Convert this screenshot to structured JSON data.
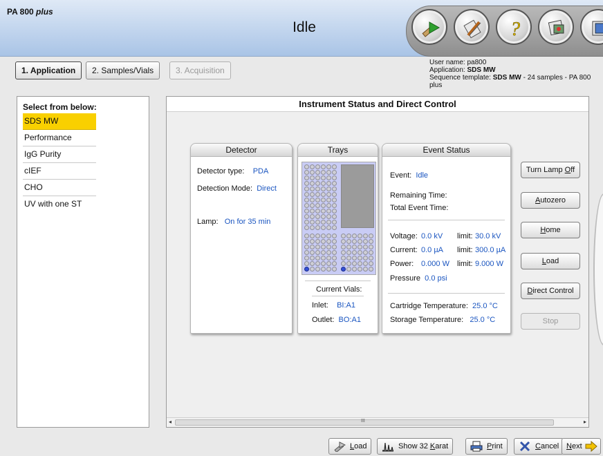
{
  "app": {
    "title": "PA 800",
    "title_suffix": "plus",
    "status": "Idle"
  },
  "toolbar": [
    {
      "icon": "run-icon"
    },
    {
      "icon": "edit-method-icon"
    },
    {
      "icon": "help-icon"
    },
    {
      "icon": "data-analysis-icon"
    },
    {
      "icon": "exit-icon"
    }
  ],
  "user": {
    "user_name_label": "User name:",
    "user_name": "pa800",
    "application_label": "Application:",
    "application": "SDS MW",
    "sequence_label": "Sequence template:",
    "sequence_strong": "SDS MW",
    "sequence_rest": "- 24 samples - PA 800 plus"
  },
  "steps": [
    {
      "label": "1. Application",
      "state": "active"
    },
    {
      "label": "2. Samples/Vials",
      "state": "enabled"
    },
    {
      "label": "3. Acquisition",
      "state": "disabled"
    }
  ],
  "sidebar": {
    "heading": "Select from below:",
    "items": [
      "SDS MW",
      "Performance",
      "IgG Purity",
      "cIEF",
      "CHO",
      "UV with one ST"
    ],
    "selected_index": 0,
    "selected_color": "#f9d000"
  },
  "main": {
    "title": "Instrument Status and Direct Control"
  },
  "detector": {
    "title": "Detector",
    "type_label": "Detector type:",
    "type": "PDA",
    "mode_label": "Detection Mode:",
    "mode": "Direct",
    "lamp_label": "Lamp:",
    "lamp": "On for 35 min"
  },
  "trays": {
    "title": "Trays",
    "current_vials_label": "Current Vials:",
    "inlet_label": "Inlet:",
    "inlet": "BI:A1",
    "outlet_label": "Outlet:",
    "outlet": "BO:A1"
  },
  "event": {
    "title": "Event Status",
    "event_label": "Event:",
    "event": "Idle",
    "remaining_label": "Remaining Time:",
    "total_label": "Total Event Time:",
    "voltage_label": "Voltage:",
    "voltage": "0.0 kV",
    "voltage_limit_label": "limit:",
    "voltage_limit": "30.0 kV",
    "current_label": "Current:",
    "current": "0.0 µA",
    "current_limit_label": "limit:",
    "current_limit": "300.0 µA",
    "power_label": "Power:",
    "power": "0.000 W",
    "power_limit_label": "limit:",
    "power_limit": "9.000 W",
    "pressure_label": "Pressure",
    "pressure": "0.0 psi",
    "cartridge_label": "Cartridge Temperature:",
    "cartridge": "25.0 °C",
    "storage_label": "Storage Temperature:",
    "storage": "25.0 °C"
  },
  "control_buttons": {
    "lamp_pre": "Turn Lamp ",
    "lamp_key": "O",
    "lamp_post": "ff",
    "autozero_key": "A",
    "autozero_post": "utozero",
    "home_key": "H",
    "home_post": "ome",
    "load_key": "L",
    "load_post": "oad",
    "direct_key": "D",
    "direct_post": "irect Control",
    "stop": "Stop"
  },
  "bottom_buttons": {
    "load_key": "L",
    "load_post": "oad",
    "show_pre": "Show 32 ",
    "show_key": "K",
    "show_post": "arat",
    "print_key": "P",
    "print_post": "rint",
    "cancel_key": "C",
    "cancel_post": "ancel",
    "next_key": "N",
    "next_post": "ext"
  },
  "scroll": {
    "marker": "III"
  },
  "colors": {
    "value_blue": "#1a55c0",
    "vial_active": "#3550d8",
    "tray_bg": "#c9ccf5"
  }
}
